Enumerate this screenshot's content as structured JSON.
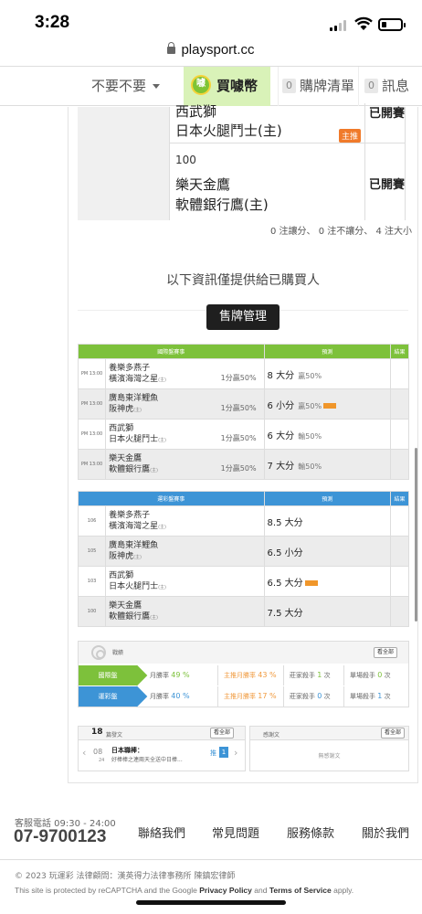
{
  "status_bar": {
    "time": "3:28"
  },
  "url_bar": {
    "domain": "playsport.cc"
  },
  "nav": {
    "user": "不要不要",
    "buy": "買噱幣",
    "coin_text": "噱",
    "cart_count": "0",
    "cart": "購牌清單",
    "msg_count": "0",
    "msg": "訊息"
  },
  "top_games": [
    {
      "num": "",
      "teams": [
        "西武獅",
        "日本火腿鬥士(主)"
      ],
      "tag": "主推",
      "status": "已開賽"
    },
    {
      "num": "100",
      "teams": [
        "樂天金鷹",
        "軟體銀行鷹(主)"
      ],
      "tag": "",
      "status": "已開賽"
    }
  ],
  "summary": "0 注讓分、 0 注不讓分、 4 注大小",
  "notice": "以下資訊僅提供給已購買人",
  "sell_button": "售牌管理",
  "intl_table": {
    "headers": [
      "國際盤賽事",
      "預測",
      "結果"
    ],
    "rows": [
      {
        "time": "PM 13:00",
        "team1": "養樂多燕子",
        "team2": "橫濱海灣之星",
        "sup": "(主)",
        "rate": "1分贏50%",
        "pred": "8 大分",
        "sub": "贏50%",
        "tag": false
      },
      {
        "time": "PM 13:00",
        "team1": "廣島東洋鯉魚",
        "team2": "阪神虎",
        "sup": "(主)",
        "rate": "1分贏50%",
        "pred": "6 小分",
        "sub": "贏50%",
        "tag": true
      },
      {
        "time": "PM 13:00",
        "team1": "西武獅",
        "team2": "日本火腿鬥士",
        "sup": "(主)",
        "rate": "1分贏50%",
        "pred": "6 大分",
        "sub": "輸50%",
        "tag": false
      },
      {
        "time": "PM 13:00",
        "team1": "樂天金鷹",
        "team2": "軟體銀行鷹",
        "sup": "(主)",
        "rate": "1分贏50%",
        "pred": "7 大分",
        "sub": "輸50%",
        "tag": false
      }
    ]
  },
  "lottery_table": {
    "headers": [
      "運彩盤賽事",
      "預測",
      "結果"
    ],
    "rows": [
      {
        "time": "106",
        "team1": "養樂多燕子",
        "team2": "橫濱海灣之星",
        "sup": "(主)",
        "pred": "8.5 大分",
        "tag": false
      },
      {
        "time": "105",
        "team1": "廣島東洋鯉魚",
        "team2": "阪神虎",
        "sup": "(主)",
        "pred": "6.5 小分",
        "tag": false
      },
      {
        "time": "103",
        "team1": "西武獅",
        "team2": "日本火腿鬥士",
        "sup": "(主)",
        "pred": "6.5 大分",
        "tag": true
      },
      {
        "time": "100",
        "team1": "樂天金鷹",
        "team2": "軟體銀行鷹",
        "sup": "(主)",
        "pred": "7.5 大分",
        "tag": false
      }
    ]
  },
  "stats": {
    "title": "戰績",
    "view_all": "看全部",
    "rows": [
      {
        "label": "國際盤",
        "monthly_label": "月勝率",
        "monthly": "49 %",
        "main_label": "主推月勝率",
        "main": "43 %",
        "zhuang_label": "莊家殺手",
        "zhuang": "1",
        "zhuang_unit": "次",
        "single_label": "單場殺手",
        "single": "0",
        "single_unit": "次"
      },
      {
        "label": "運彩盤",
        "monthly_label": "月勝率",
        "monthly": "40 %",
        "main_label": "主推月勝率",
        "main": "17 %",
        "zhuang_label": "莊家殺手",
        "zhuang": "0",
        "zhuang_unit": "次",
        "single_label": "單場殺手",
        "single": "1",
        "single_unit": "次"
      }
    ]
  },
  "posts": {
    "count": "18",
    "title": "篇發文",
    "view_all": "看全部",
    "prev": "‹",
    "next": "›",
    "month": "08",
    "day": "24",
    "post_title": "日本職棒：",
    "post_snippet": "好棒棒之連兩天全送中日棒...",
    "post_tag": "推",
    "post_count": "1"
  },
  "thanks": {
    "title": "感謝文",
    "view_all": "看全部",
    "empty": "無感謝文"
  },
  "footer": {
    "hotline_label": "客服電話 09:30 - 24:00",
    "hotline": "07-9700123",
    "links": [
      "聯絡我們",
      "常見問題",
      "服務條款",
      "關於我們"
    ],
    "copyright": "© 2023 玩運彩 法律顧問：漢英得力法律事務所 陳鎮宏律師",
    "recaptcha_pre": "This site is protected by reCAPTCHA and the Google",
    "privacy": "Privacy Policy",
    "and": "and",
    "terms": "Terms of Service",
    "apply": "apply."
  }
}
